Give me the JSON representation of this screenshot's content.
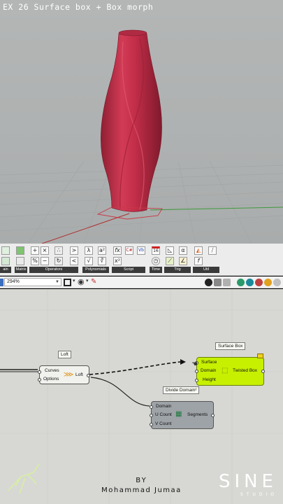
{
  "viewport": {
    "title": "EX 26 Surface box + Box morph"
  },
  "ribbon": {
    "groups": [
      {
        "label": "ain"
      },
      {
        "label": "Matrix"
      },
      {
        "label": "Operators"
      },
      {
        "label": "Polynomials"
      },
      {
        "label": "Script"
      },
      {
        "label": "Time"
      },
      {
        "label": "Trig"
      },
      {
        "label": "Util"
      }
    ],
    "buttons": {
      "gt": ">",
      "lt": "<",
      "times": "×",
      "minus": "−",
      "plus": "+",
      "percent": "%",
      "fx": "fx",
      "cs": "C#",
      "vb": "Vb",
      "x2": "x²",
      "sqrt": "√",
      "cal": "16",
      "f": "f",
      "alpha": "α",
      "a2": "a²"
    }
  },
  "canvas_toolbar": {
    "zoom": "294%"
  },
  "canvas": {
    "loft": {
      "tag": "Loft",
      "inputs": [
        "Curves",
        "Options"
      ],
      "output": "Loft"
    },
    "surface_box": {
      "tag": "Surface Box",
      "inputs": [
        "Surface",
        "Domain",
        "Height"
      ],
      "output": "Twisted Box"
    },
    "divide_domain": {
      "tag": "Divide Domain²",
      "inputs": [
        "Domain",
        "U Count",
        "V Count"
      ],
      "output": "Segments"
    },
    "credit": {
      "by": "BY",
      "name": "Mohammad Jumaa"
    },
    "studio": {
      "name": "SINE",
      "sub": "STUDIO"
    }
  },
  "colors": {
    "vase": "#c8314b",
    "selected_component": "#c6f000",
    "component": "#9ea3a8",
    "canvas": "#d7d8d3",
    "viewport_bg": "#b0b3b3"
  }
}
